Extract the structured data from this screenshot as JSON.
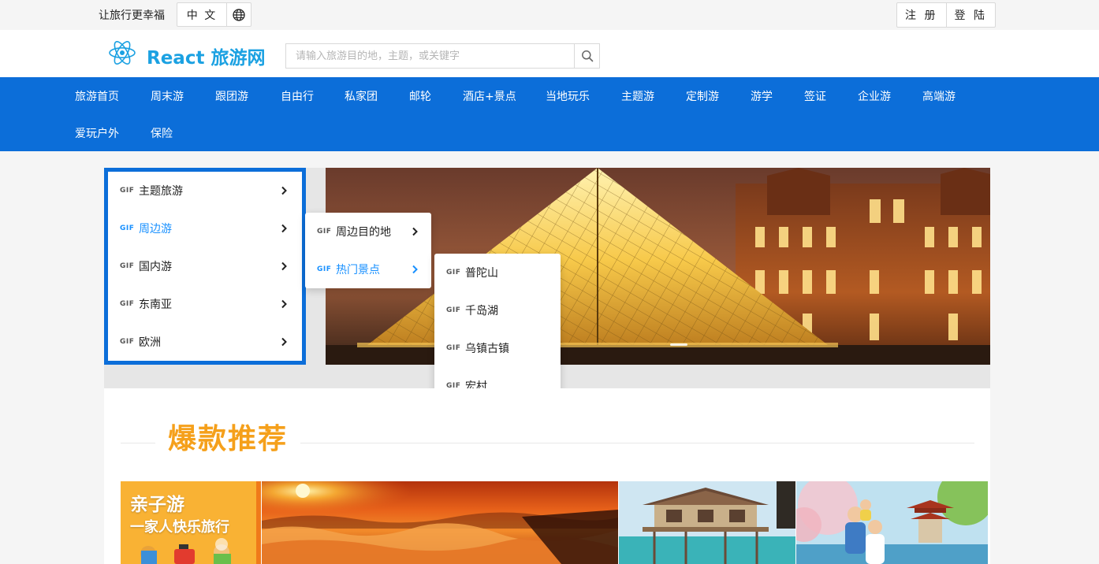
{
  "topbar": {
    "slogan": "让旅行更幸福",
    "language_button": "中 文",
    "language_icon": "globe-icon",
    "register_label": "注 册",
    "login_label": "登 陆"
  },
  "header": {
    "logo_icon": "react-logo-icon",
    "logo_text": "React 旅游网",
    "search_placeholder": "请输入旅游目的地，主题，或关键字",
    "search_value": "",
    "search_icon": "search-icon"
  },
  "nav": {
    "items": [
      "旅游首页",
      "周末游",
      "跟团游",
      "自由行",
      "私家团",
      "邮轮",
      "酒店+景点",
      "当地玩乐",
      "主题游",
      "定制游",
      "游学",
      "签证",
      "企业游",
      "高端游",
      "爱玩户外",
      "保险"
    ]
  },
  "side_menu": {
    "tag": "GIF",
    "items": [
      "主题旅游",
      "周边游",
      "国内游",
      "东南亚",
      "欧洲"
    ],
    "active": "周边游"
  },
  "submenu_level2": {
    "items": [
      "周边目的地",
      "热门景点"
    ],
    "active": "热门景点"
  },
  "submenu_level3": {
    "items": [
      "普陀山",
      "千岛湖",
      "乌镇古镇",
      "宏村"
    ]
  },
  "hot_section": {
    "title": "爆款推荐",
    "promo_title": "亲子游",
    "promo_subtitle": "一家人快乐旅行"
  },
  "colors": {
    "nav_blue": "#0c6ed9",
    "logo_blue": "#1ba1e2",
    "active_blue": "#1890ff",
    "hot_orange": "#f5a01b"
  }
}
